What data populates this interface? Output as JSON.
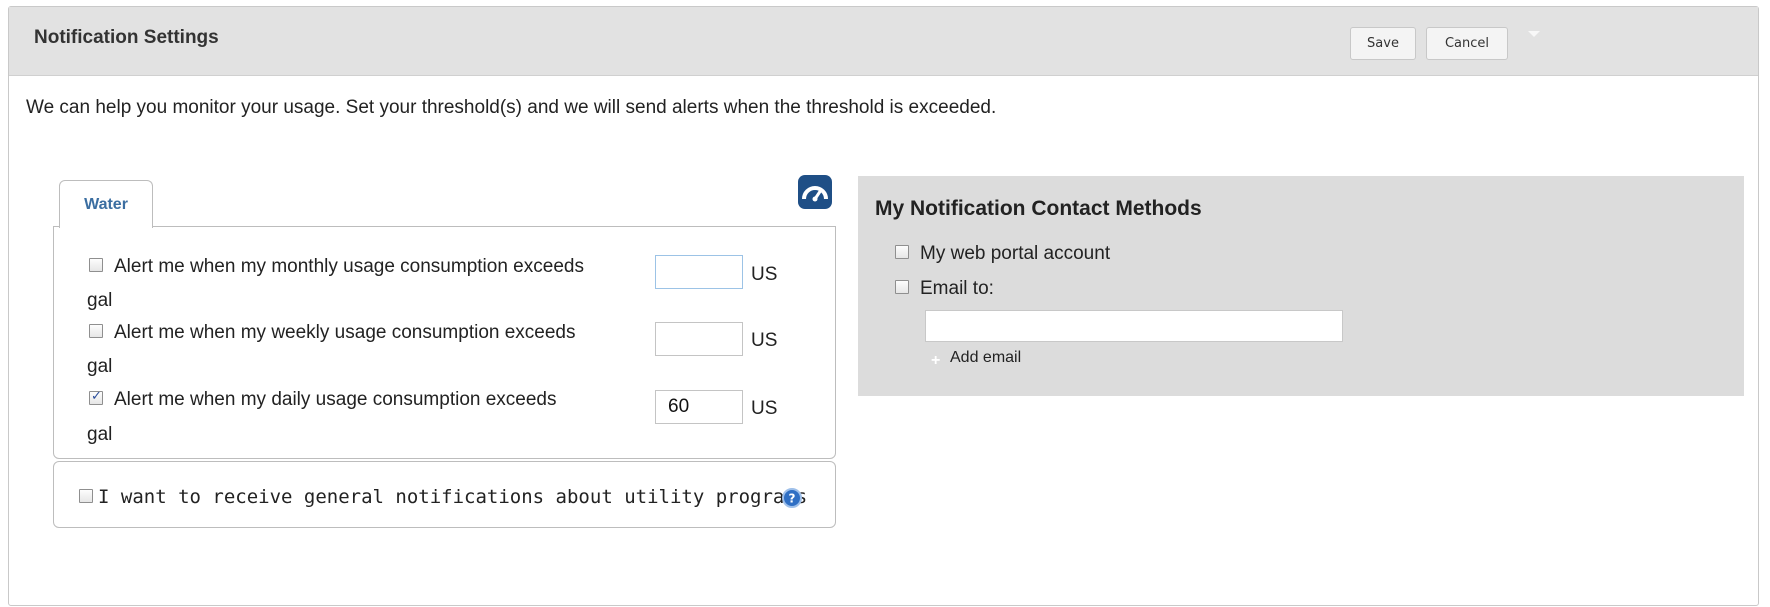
{
  "header": {
    "title": "Notification Settings",
    "save_label": "Save",
    "cancel_label": "Cancel"
  },
  "intro_text": "We can help you monitor your usage. Set your threshold(s) and we will send alerts when the threshold is exceeded.",
  "tabs": [
    {
      "label": "Water",
      "selected": true
    }
  ],
  "alerts": [
    {
      "label": "Alert me when my monthly usage consumption exceeds",
      "value": "",
      "unit_a": "US",
      "unit_b": "gal",
      "checked": false
    },
    {
      "label": "Alert me when my weekly usage consumption exceeds",
      "value": "",
      "unit_a": "US",
      "unit_b": "gal",
      "checked": false
    },
    {
      "label": "Alert me when my daily usage consumption exceeds",
      "value": "60",
      "unit_a": "US",
      "unit_b": "gal",
      "checked": true
    }
  ],
  "general_notifications": {
    "label": "I want to receive general notifications about utility programs",
    "checked": false
  },
  "contact": {
    "title": "My Notification Contact Methods",
    "web_portal_label": "My web portal account",
    "web_portal_checked": false,
    "email_label": "Email to:",
    "email_checked": false,
    "email_value": "",
    "add_email_label": "Add email"
  },
  "icons": {
    "gauge": "gauge-icon",
    "help": "help-icon",
    "collapse": "chevron-down-icon",
    "add": "plus-icon"
  },
  "colors": {
    "header_bg": "#e2e2e2",
    "tab_text": "#3b6ea1",
    "contact_panel_bg": "#dcdcdc",
    "gauge_icon": "#1f4f86",
    "help_icon": "#2f6fc4"
  }
}
